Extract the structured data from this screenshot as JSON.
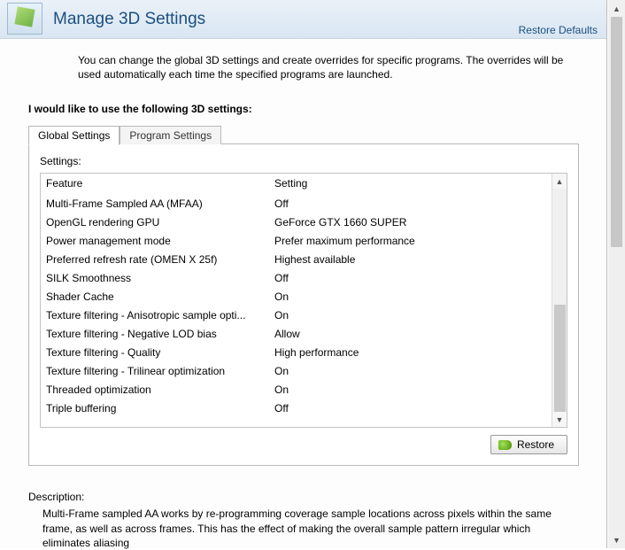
{
  "header": {
    "title": "Manage 3D Settings",
    "restore_defaults": "Restore Defaults"
  },
  "intro": "You can change the global 3D settings and create overrides for specific programs. The overrides will be used automatically each time the specified programs are launched.",
  "section_heading": "I would like to use the following 3D settings:",
  "tabs": {
    "global": "Global Settings",
    "program": "Program Settings"
  },
  "settings_label": "Settings:",
  "columns": {
    "feature": "Feature",
    "setting": "Setting"
  },
  "rows": [
    {
      "feature": "Multi-Frame Sampled AA (MFAA)",
      "setting": "Off"
    },
    {
      "feature": "OpenGL rendering GPU",
      "setting": "GeForce GTX 1660 SUPER"
    },
    {
      "feature": "Power management mode",
      "setting": "Prefer maximum performance"
    },
    {
      "feature": "Preferred refresh rate (OMEN X 25f)",
      "setting": "Highest available"
    },
    {
      "feature": "SILK Smoothness",
      "setting": "Off"
    },
    {
      "feature": "Shader Cache",
      "setting": "On"
    },
    {
      "feature": "Texture filtering - Anisotropic sample opti...",
      "setting": "On"
    },
    {
      "feature": "Texture filtering - Negative LOD bias",
      "setting": "Allow"
    },
    {
      "feature": "Texture filtering - Quality",
      "setting": "High performance"
    },
    {
      "feature": "Texture filtering - Trilinear optimization",
      "setting": "On"
    },
    {
      "feature": "Threaded optimization",
      "setting": "On"
    },
    {
      "feature": "Triple buffering",
      "setting": "Off"
    }
  ],
  "restore_button": "Restore",
  "description": {
    "label": "Description:",
    "text": "Multi-Frame sampled AA works by re-programming coverage sample locations across pixels within the same frame, as well as across frames. This has the effect of making the overall sample pattern irregular which eliminates aliasing"
  },
  "icons": {
    "up": "▲",
    "down": "▼"
  }
}
